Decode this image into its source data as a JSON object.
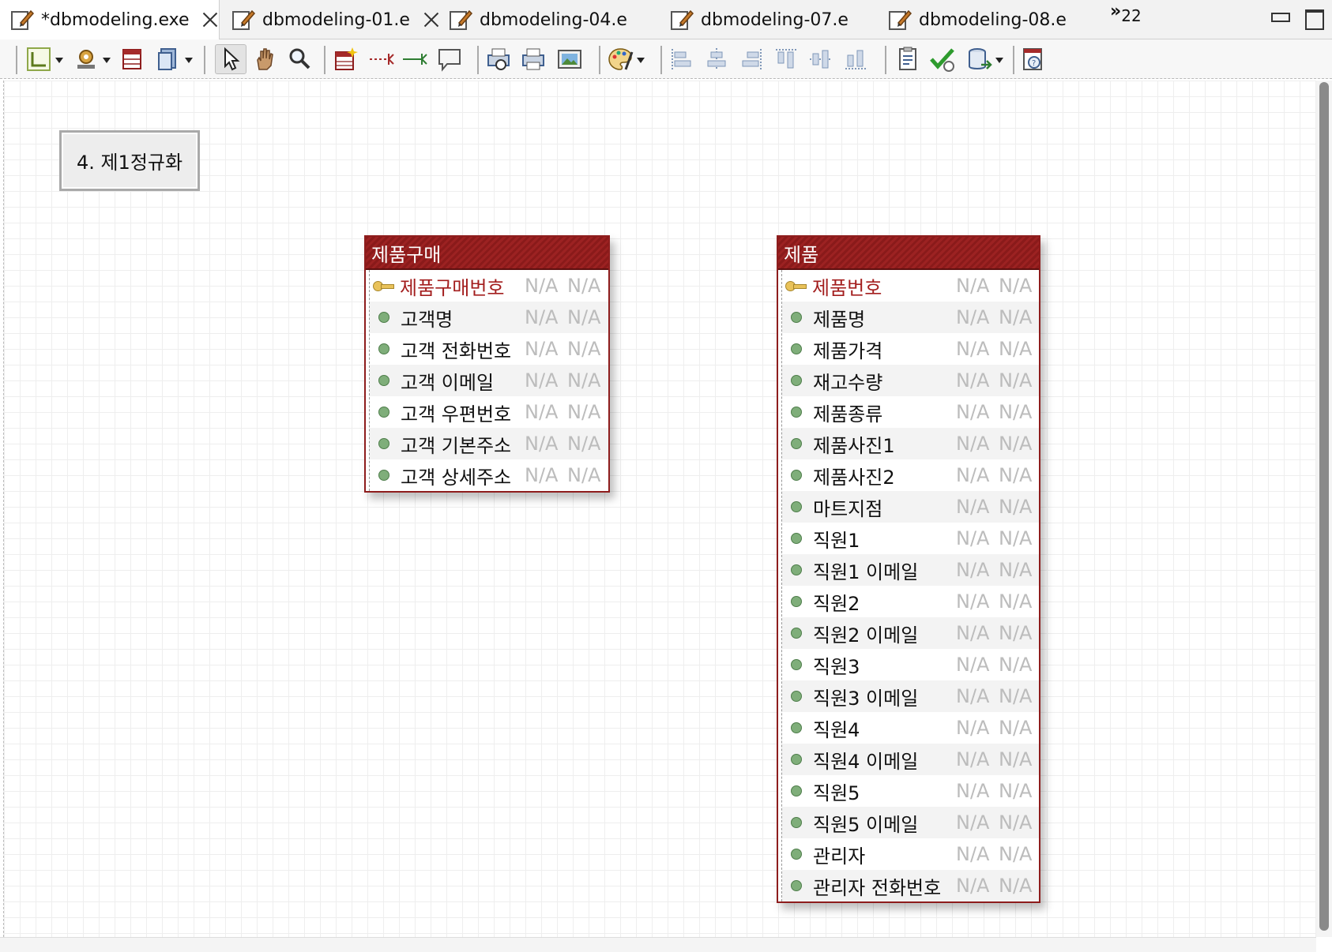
{
  "tabs": [
    {
      "label": "*dbmodeling.exe",
      "active": true,
      "closable": true
    },
    {
      "label": "dbmodeling-01.e",
      "active": false,
      "closable": true
    },
    {
      "label": "dbmodeling-04.e",
      "active": false,
      "closable": false
    },
    {
      "label": "dbmodeling-07.e",
      "active": false,
      "closable": false
    },
    {
      "label": "dbmodeling-08.e",
      "active": false,
      "closable": false
    }
  ],
  "overflow": {
    "chevron": "»",
    "count": "22"
  },
  "toolbar": {
    "icons": [
      "layout-icon",
      "settings-icon",
      "table-icon",
      "copy-icon",
      "select-arrow-icon",
      "hand-icon",
      "zoom-icon",
      "new-table-icon",
      "relation-dashed-icon",
      "relation-icon",
      "comment-icon",
      "print-preview-icon",
      "print-icon",
      "image-export-icon",
      "palette-icon",
      "align-left-icon",
      "align-center-icon",
      "align-right-icon",
      "align-top-icon",
      "align-middle-icon",
      "align-bottom-icon",
      "report-icon",
      "validate-check-icon",
      "export-icon",
      "help-icon"
    ]
  },
  "note": {
    "label": "4. 제1정규화"
  },
  "entities": {
    "purchase": {
      "title": "제품구매",
      "columns": [
        {
          "name": "제품구매번호",
          "pk": true,
          "logical": "N/A",
          "physical": "N/A"
        },
        {
          "name": "고객명",
          "pk": false,
          "logical": "N/A",
          "physical": "N/A"
        },
        {
          "name": "고객 전화번호",
          "pk": false,
          "logical": "N/A",
          "physical": "N/A"
        },
        {
          "name": "고객 이메일",
          "pk": false,
          "logical": "N/A",
          "physical": "N/A"
        },
        {
          "name": "고객 우편번호",
          "pk": false,
          "logical": "N/A",
          "physical": "N/A"
        },
        {
          "name": "고객 기본주소",
          "pk": false,
          "logical": "N/A",
          "physical": "N/A"
        },
        {
          "name": "고객 상세주소",
          "pk": false,
          "logical": "N/A",
          "physical": "N/A"
        }
      ]
    },
    "product": {
      "title": "제품",
      "columns": [
        {
          "name": "제품번호",
          "pk": true,
          "logical": "N/A",
          "physical": "N/A"
        },
        {
          "name": "제품명",
          "pk": false,
          "logical": "N/A",
          "physical": "N/A"
        },
        {
          "name": "제품가격",
          "pk": false,
          "logical": "N/A",
          "physical": "N/A"
        },
        {
          "name": "재고수량",
          "pk": false,
          "logical": "N/A",
          "physical": "N/A"
        },
        {
          "name": "제품종류",
          "pk": false,
          "logical": "N/A",
          "physical": "N/A"
        },
        {
          "name": "제품사진1",
          "pk": false,
          "logical": "N/A",
          "physical": "N/A"
        },
        {
          "name": "제품사진2",
          "pk": false,
          "logical": "N/A",
          "physical": "N/A"
        },
        {
          "name": "마트지점",
          "pk": false,
          "logical": "N/A",
          "physical": "N/A"
        },
        {
          "name": "직원1",
          "pk": false,
          "logical": "N/A",
          "physical": "N/A"
        },
        {
          "name": "직원1 이메일",
          "pk": false,
          "logical": "N/A",
          "physical": "N/A"
        },
        {
          "name": "직원2",
          "pk": false,
          "logical": "N/A",
          "physical": "N/A"
        },
        {
          "name": "직원2 이메일",
          "pk": false,
          "logical": "N/A",
          "physical": "N/A"
        },
        {
          "name": "직원3",
          "pk": false,
          "logical": "N/A",
          "physical": "N/A"
        },
        {
          "name": "직원3 이메일",
          "pk": false,
          "logical": "N/A",
          "physical": "N/A"
        },
        {
          "name": "직원4",
          "pk": false,
          "logical": "N/A",
          "physical": "N/A"
        },
        {
          "name": "직원4 이메일",
          "pk": false,
          "logical": "N/A",
          "physical": "N/A"
        },
        {
          "name": "직원5",
          "pk": false,
          "logical": "N/A",
          "physical": "N/A"
        },
        {
          "name": "직원5 이메일",
          "pk": false,
          "logical": "N/A",
          "physical": "N/A"
        },
        {
          "name": "관리자",
          "pk": false,
          "logical": "N/A",
          "physical": "N/A"
        },
        {
          "name": "관리자 전화번호",
          "pk": false,
          "logical": "N/A",
          "physical": "N/A"
        }
      ]
    }
  },
  "colors": {
    "entity_header": "#8e1d1d",
    "pk_text": "#a31e1e",
    "na_text": "#bcbcbc",
    "attr_bullet": "#7fae7a"
  }
}
